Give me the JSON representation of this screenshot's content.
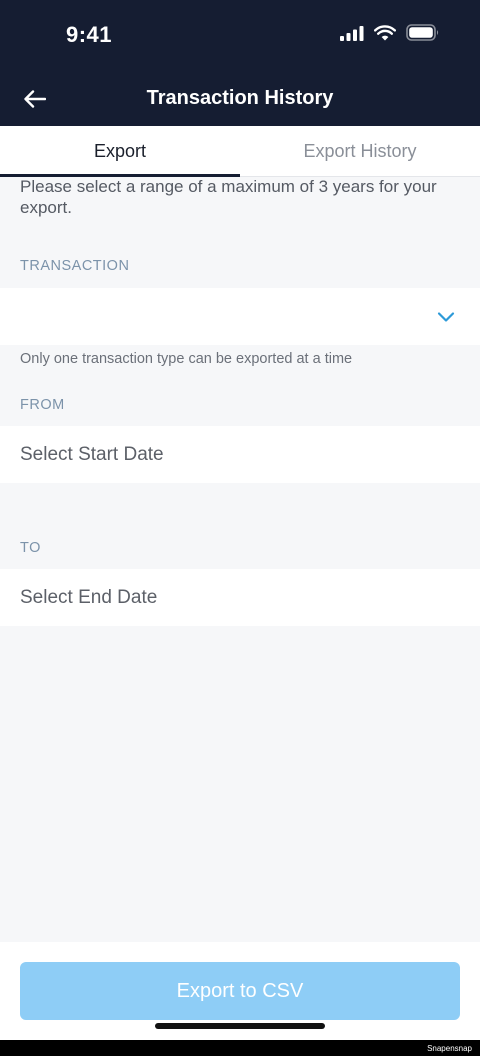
{
  "status_bar": {
    "time": "9:41"
  },
  "nav": {
    "title": "Transaction History"
  },
  "tabs": [
    {
      "label": "Export",
      "active": true
    },
    {
      "label": "Export History",
      "active": false
    }
  ],
  "form": {
    "instruction": "Please select a range of a maximum of 3 years for your export.",
    "transaction": {
      "label": "TRANSACTION",
      "value": "",
      "hint": "Only one transaction type can be exported at a time"
    },
    "from": {
      "label": "FROM",
      "placeholder": "Select Start Date"
    },
    "to": {
      "label": "TO",
      "placeholder": "Select End Date"
    }
  },
  "actions": {
    "export_label": "Export to CSV"
  },
  "watermark": "Snapensnap",
  "colors": {
    "header_bg": "#151d32",
    "accent": "#2d9ad8",
    "button_disabled": "#8ecdf6",
    "label": "#7c93aa"
  }
}
